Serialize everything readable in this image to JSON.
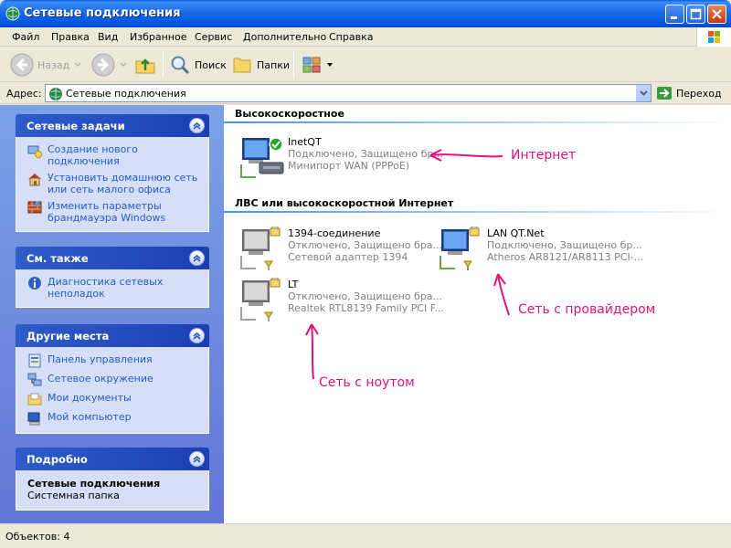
{
  "window": {
    "title": "Сетевые подключения"
  },
  "menu": [
    "Файл",
    "Правка",
    "Вид",
    "Избранное",
    "Сервис",
    "Дополнительно",
    "Справка"
  ],
  "toolbar": {
    "back_label": "Назад",
    "search_label": "Поиск",
    "folders_label": "Папки"
  },
  "address": {
    "label": "Адрес:",
    "value": "Сетевые подключения",
    "go_label": "Переход"
  },
  "sidebar": {
    "network_tasks": {
      "title": "Сетевые задачи",
      "items": [
        {
          "label": "Создание нового подключения",
          "icon": "new-connection-icon"
        },
        {
          "label": "Установить домашнюю сеть или сеть малого офиса",
          "icon": "home-network-icon"
        },
        {
          "label": "Изменить параметры брандмауэра Windows",
          "icon": "firewall-icon"
        }
      ]
    },
    "see_also": {
      "title": "См. также",
      "items": [
        {
          "label": "Диагностика сетевых неполадок",
          "icon": "info-icon"
        }
      ]
    },
    "other_places": {
      "title": "Другие места",
      "items": [
        {
          "label": "Панель управления",
          "icon": "control-panel-icon"
        },
        {
          "label": "Сетевое окружение",
          "icon": "network-places-icon"
        },
        {
          "label": "Мои документы",
          "icon": "my-documents-icon"
        },
        {
          "label": "Мой компьютер",
          "icon": "my-computer-icon"
        }
      ]
    },
    "details": {
      "title": "Подробно",
      "name": "Сетевые подключения",
      "type": "Системная папка"
    }
  },
  "groups": {
    "broadband": {
      "title": "Высокоскоростное",
      "connections": [
        {
          "name": "InetQT",
          "status": "Подключено, Защищено бр...",
          "device": "Минипорт WAN (PPPoE)"
        }
      ]
    },
    "lan": {
      "title": "ЛВС или высокоскоростной Интернет",
      "connections": [
        {
          "name": "1394-соединение",
          "status": "Отключено, Защищено бра...",
          "device": "Сетевой адаптер 1394"
        },
        {
          "name": "LAN QT.Net",
          "status": "Подключено, Защищено бр...",
          "device": "Atheros AR8121/AR8113 PCI-..."
        },
        {
          "name": "LT",
          "status": "Отключено, Защищено бра...",
          "device": "Realtek RTL8139 Family PCI F..."
        }
      ]
    }
  },
  "annotations": {
    "internet": "Интернет",
    "provider": "Сеть с провайдером",
    "laptop": "Сеть с ноутом"
  },
  "status": {
    "text": "Объектов: 4"
  },
  "colors": {
    "annotation": "#e4127a",
    "link": "#215dc6",
    "titlebar": "#0054e3"
  }
}
